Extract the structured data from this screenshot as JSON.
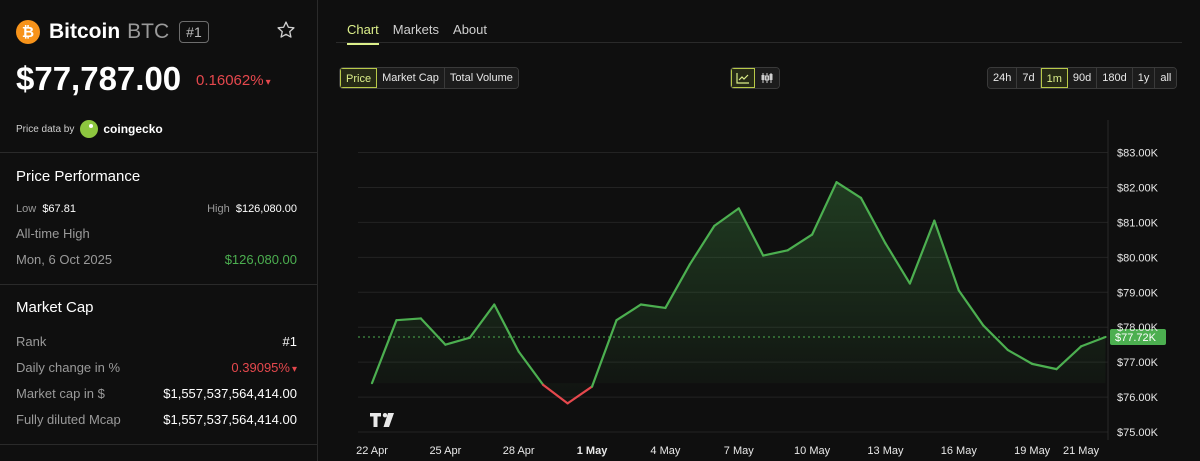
{
  "coin": {
    "name": "Bitcoin",
    "symbol": "BTC",
    "rank_badge": "#1",
    "logo_glyph": "₿",
    "price": "$77,787.00",
    "change": "0.16062%",
    "change_arrow": "▾"
  },
  "price_source": {
    "label": "Price data by",
    "name": "coingecko"
  },
  "performance": {
    "title": "Price Performance",
    "low_label": "Low",
    "low_value": "$67.81",
    "high_label": "High",
    "high_value": "$126,080.00",
    "ath_label": "All-time High",
    "ath_date": "Mon, 6 Oct 2025",
    "ath_value": "$126,080.00"
  },
  "market_cap": {
    "title": "Market Cap",
    "rank_label": "Rank",
    "rank_value": "#1",
    "daily_change_label": "Daily change in %",
    "daily_change_value": "0.39095%",
    "daily_change_arrow": "▾",
    "mcap_label": "Market cap in $",
    "mcap_value": "$1,557,537,564,414.00",
    "fdv_label": "Fully diluted Mcap",
    "fdv_value": "$1,557,537,564,414.00"
  },
  "tabs": [
    "Chart",
    "Markets",
    "About"
  ],
  "metric_buttons": [
    "Price",
    "Market Cap",
    "Total Volume"
  ],
  "range_buttons": [
    "24h",
    "7d",
    "1m",
    "90d",
    "180d",
    "1y",
    "all"
  ],
  "selected_range": "1m",
  "selected_metric": "Price",
  "icons": {
    "star": "star-icon",
    "line_chart": "line-chart-icon",
    "candles": "candlestick-icon",
    "tv_logo": "tradingview-logo"
  },
  "colors": {
    "up": "#4caf50",
    "down": "#e5484d",
    "accent": "#dcef8a",
    "brand": "#f7931a"
  },
  "chart_data": {
    "type": "line",
    "x_labels": [
      "22 Apr",
      "25 Apr",
      "28 Apr",
      "1 May",
      "4 May",
      "7 May",
      "10 May",
      "13 May",
      "16 May",
      "19 May",
      "21 May"
    ],
    "y_ticks": [
      "$83.00K",
      "$82.00K",
      "$81.00K",
      "$80.00K",
      "$79.00K",
      "$78.00K",
      "$77.00K",
      "$76.00K",
      "$75.00K"
    ],
    "y_tick_values": [
      83000,
      82000,
      81000,
      80000,
      79000,
      78000,
      77000,
      76000,
      75000
    ],
    "ylim": [
      74800,
      83400
    ],
    "last_price_label": "$77.72K",
    "last_price": 77720,
    "points": [
      {
        "day": 0,
        "v": 76400
      },
      {
        "day": 1,
        "v": 78200
      },
      {
        "day": 2,
        "v": 78250
      },
      {
        "day": 3,
        "v": 77500
      },
      {
        "day": 4,
        "v": 77700
      },
      {
        "day": 5,
        "v": 78650
      },
      {
        "day": 6,
        "v": 77300
      },
      {
        "day": 7,
        "v": 76350
      },
      {
        "day": 8,
        "v": 75820
      },
      {
        "day": 9,
        "v": 76300
      },
      {
        "day": 10,
        "v": 78200
      },
      {
        "day": 11,
        "v": 78650
      },
      {
        "day": 12,
        "v": 78550
      },
      {
        "day": 13,
        "v": 79800
      },
      {
        "day": 14,
        "v": 80900
      },
      {
        "day": 15,
        "v": 81400
      },
      {
        "day": 16,
        "v": 80050
      },
      {
        "day": 17,
        "v": 80200
      },
      {
        "day": 18,
        "v": 80650
      },
      {
        "day": 19,
        "v": 82150
      },
      {
        "day": 20,
        "v": 81700
      },
      {
        "day": 21,
        "v": 80400
      },
      {
        "day": 22,
        "v": 79250
      },
      {
        "day": 23,
        "v": 81050
      },
      {
        "day": 24,
        "v": 79050
      },
      {
        "day": 25,
        "v": 78050
      },
      {
        "day": 26,
        "v": 77350
      },
      {
        "day": 27,
        "v": 76950
      },
      {
        "day": 28,
        "v": 76800
      },
      {
        "day": 29,
        "v": 77450
      },
      {
        "day": 30,
        "v": 77720
      }
    ]
  }
}
